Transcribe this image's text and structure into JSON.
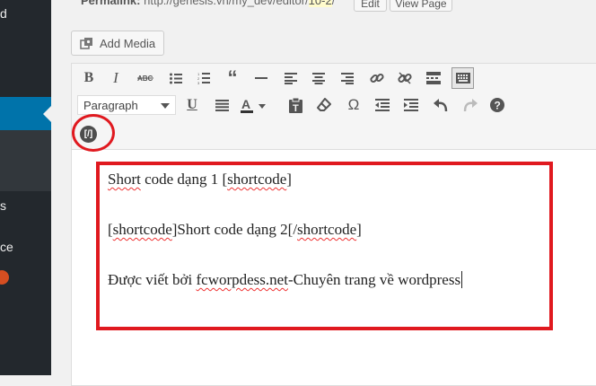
{
  "sidebar": {
    "items": [
      {
        "label": "d"
      },
      {
        "label": "s"
      },
      {
        "label": "ce"
      }
    ]
  },
  "permalink": {
    "label": "Permalink:",
    "url_prefix": "http://genesis.vn/my_dev/editor/",
    "url_slug": "10-2",
    "url_suffix": "/",
    "edit_label": "Edit",
    "view_label": "View Page"
  },
  "editor": {
    "add_media_label": "Add Media",
    "format_select": {
      "selected": "Paragraph"
    },
    "shortcode_button_label": "[/]",
    "toolbar_row1_icons": [
      "bold-icon",
      "italic-icon",
      "strikethrough-icon",
      "bullet-list-icon",
      "numbered-list-icon",
      "blockquote-icon",
      "horizontal-line-icon",
      "align-left-icon",
      "align-center-icon",
      "align-right-icon",
      "insert-link-icon",
      "remove-link-icon",
      "read-more-icon",
      "toolbar-toggle-icon"
    ],
    "toolbar_row2_icons": [
      "underline-icon",
      "justify-icon",
      "text-color-icon",
      "paste-as-text-icon",
      "clear-formatting-icon",
      "special-character-icon",
      "outdent-icon",
      "indent-icon",
      "undo-icon",
      "redo-icon",
      "help-icon"
    ]
  },
  "content": {
    "line1": {
      "w1": "Short",
      "rest": " code dạng 1 [",
      "sc": "shortcode",
      "end": "]"
    },
    "line2": {
      "open": "[",
      "sc1": "shortcode",
      "mid": "]Short code dạng 2[/",
      "sc2": "shortcode",
      "end": "]"
    },
    "line3": {
      "pre": "Được viết bởi ",
      "site": "fcworpdess.net",
      "post": "-Chuyên trang về wordpress"
    }
  },
  "colors": {
    "highlight": "#e0191f",
    "sidebar": "#23282d",
    "active": "#0073aa"
  }
}
